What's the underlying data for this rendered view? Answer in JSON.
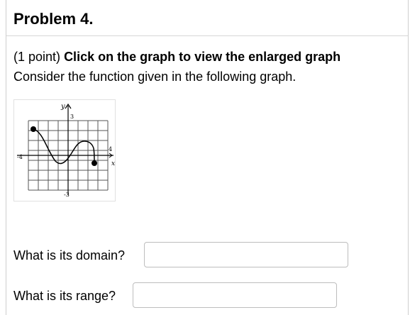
{
  "problem": {
    "title": "Problem 4."
  },
  "intro": {
    "points": "(1 point)",
    "click_instruction": "Click on the graph to view the enlarged graph",
    "description": "Consider the function given in the following graph."
  },
  "graph": {
    "y_axis_letter": "y",
    "x_axis_letter": "x",
    "y_top_label": "3",
    "y_bottom_label": "-3",
    "x_left_label": "-4",
    "x_right_label": "4"
  },
  "questions": [
    {
      "label": "What is its domain?",
      "value": ""
    },
    {
      "label": "What is its range?",
      "value": ""
    }
  ]
}
